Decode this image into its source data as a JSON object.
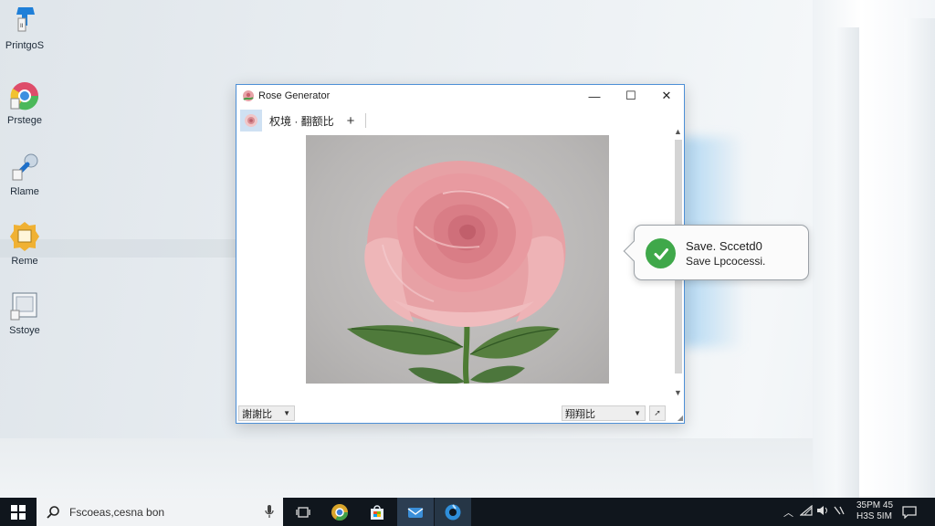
{
  "desktop": {
    "icons": [
      {
        "label": "PrintgoS",
        "icon": "printer-app-icon"
      },
      {
        "label": "Prstege",
        "icon": "chrome-like-icon"
      },
      {
        "label": "Rlame",
        "icon": "settings-app-icon"
      },
      {
        "label": "Reme",
        "icon": "folder-app-icon"
      },
      {
        "label": "Sstoye",
        "icon": "blank-doc-icon"
      }
    ]
  },
  "window": {
    "title": "Rose Generator",
    "minimize": "—",
    "maximize": "☐",
    "close": "✕",
    "toolbar": {
      "tab_label": "权境 · 翻额比",
      "add": "+"
    },
    "canvas_image": "rose-image",
    "status": {
      "left_select": "謝謝比",
      "right_select": "翔翔比",
      "go": "➚"
    }
  },
  "toast": {
    "line1": "Save. Sccetd0",
    "line2": "Save Lpcocessi."
  },
  "taskbar": {
    "search_placeholder": "Fscoeas,cesna bon",
    "clock_time": "35PM 45",
    "clock_date": "H3S 5IM"
  },
  "colors": {
    "accent": "#4d8fd6",
    "success": "#3fa84a",
    "taskbar": "#10161d",
    "rose": "#e9a3a7"
  }
}
